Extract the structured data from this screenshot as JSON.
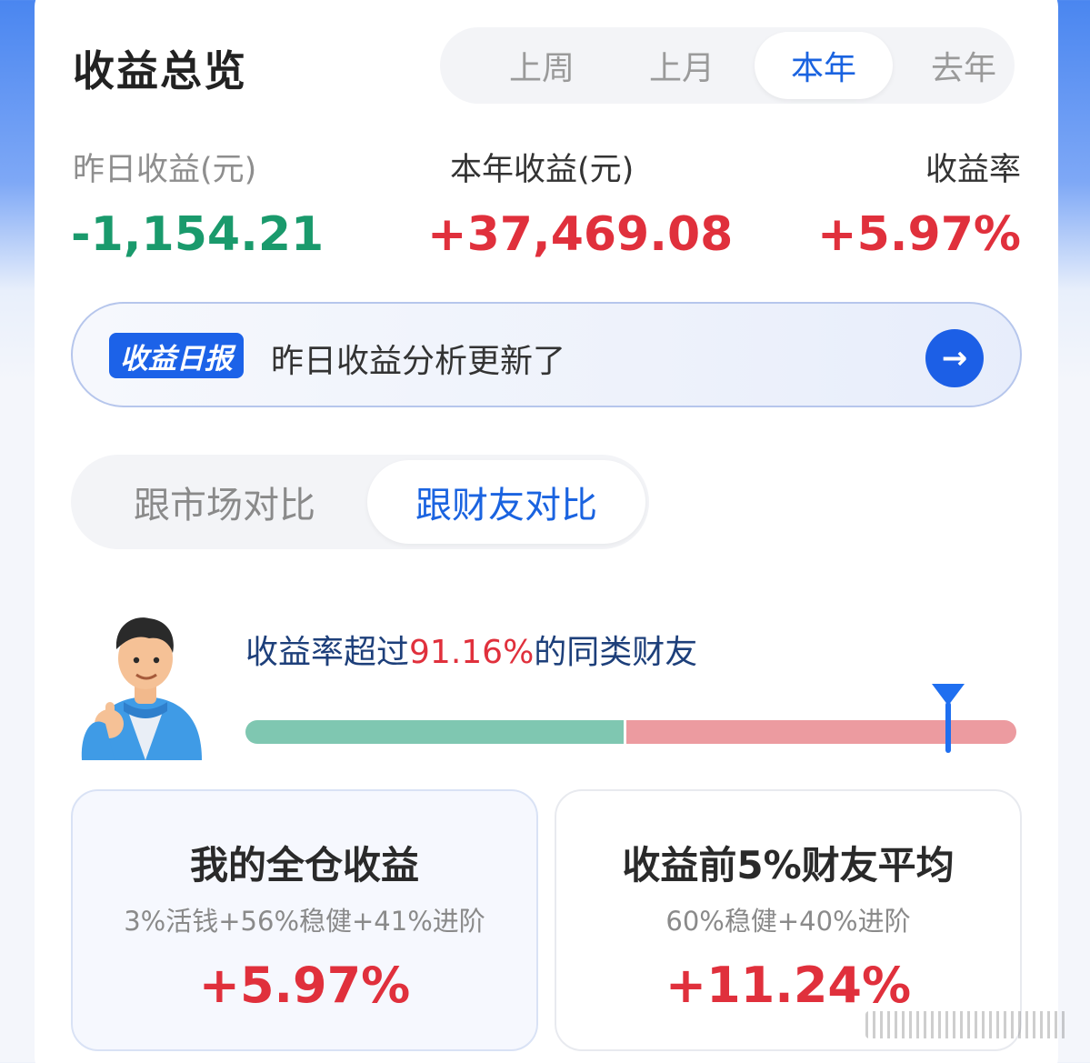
{
  "overview": {
    "title": "收益总览",
    "period_tabs": [
      {
        "label": "上周",
        "active": false
      },
      {
        "label": "上月",
        "active": false
      },
      {
        "label": "本年",
        "active": true
      },
      {
        "label": "去年",
        "active": false
      }
    ]
  },
  "stats": {
    "yesterday": {
      "label": "昨日收益(元)",
      "value": "-1,154.21",
      "color": "#1a9a6c"
    },
    "year": {
      "label": "本年收益(元)",
      "value": "+37,469.08",
      "color": "#e0303c"
    },
    "rate": {
      "label": "收益率",
      "value": "+5.97%",
      "color": "#e0303c"
    }
  },
  "daily_report": {
    "tag": "收益日报",
    "text": "昨日收益分析更新了",
    "arrow_icon": "arrow-right-icon"
  },
  "compare_tabs": [
    {
      "label": "跟市场对比",
      "active": false
    },
    {
      "label": "跟财友对比",
      "active": true
    }
  ],
  "ranking": {
    "text_prefix": "收益率超过",
    "percent": "91.16%",
    "text_suffix": "的同类财友",
    "bar_split_fraction": 0.49,
    "marker_fraction": 0.9116,
    "colors": {
      "loss": "#7fc7b1",
      "gain": "#ec9ba0",
      "marker": "#1f6ff0"
    }
  },
  "comparison": {
    "mine": {
      "title": "我的全仓收益",
      "allocation": "3%活钱+56%稳健+41%进阶",
      "value": "+5.97%"
    },
    "top_avg": {
      "title": "收益前5%财友平均",
      "allocation": "60%稳健+40%进阶",
      "value": "+11.24%"
    }
  }
}
